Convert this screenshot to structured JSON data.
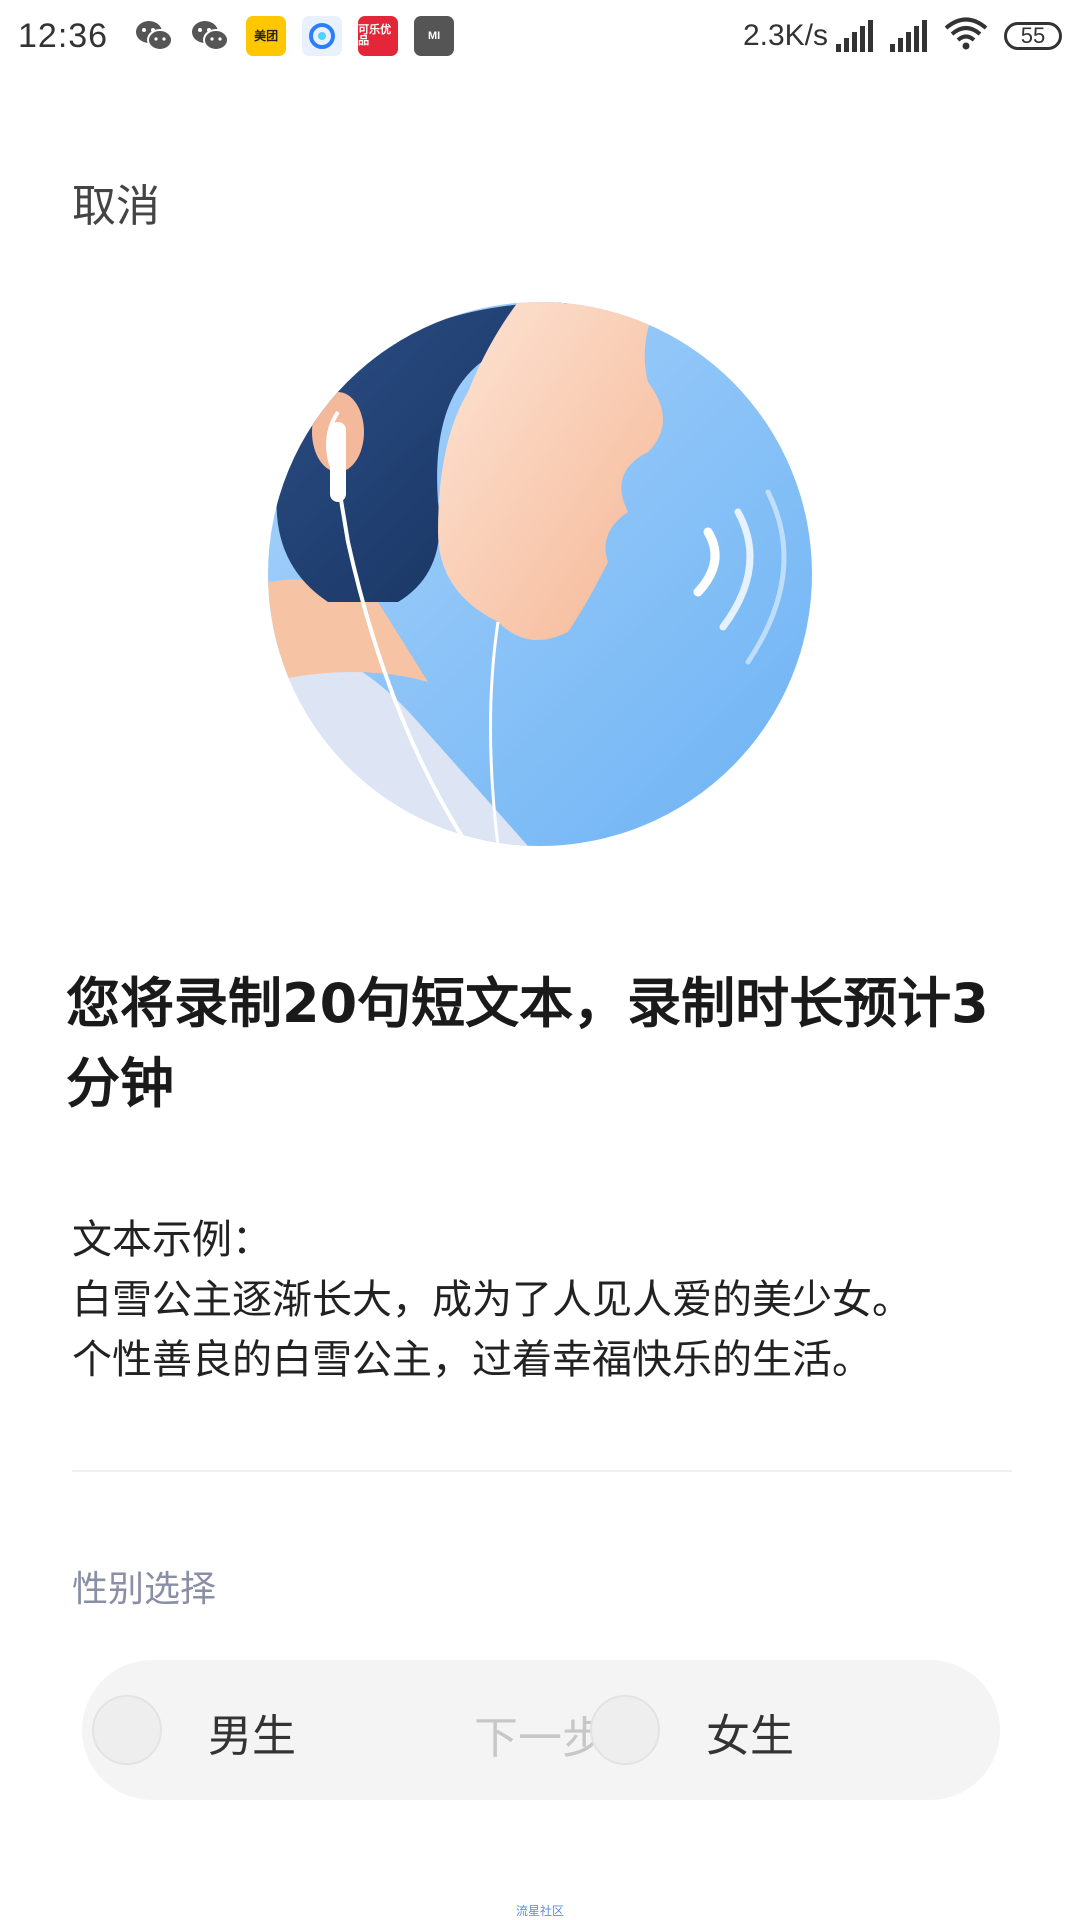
{
  "status_bar": {
    "time": "12:36",
    "net_speed": "2.3K/s",
    "battery": "55",
    "notif_meituan": "美团",
    "notif_kele": "可乐优品",
    "notif_mi": "MI"
  },
  "header": {
    "cancel_label": "取消"
  },
  "main": {
    "headline": "您将录制20句短文本，录制时长预计3分钟",
    "example_title": "文本示例：",
    "example_lines": [
      "白雪公主逐渐长大，成为了人见人爱的美少女。",
      "个性善良的白雪公主，过着幸福快乐的生活。"
    ]
  },
  "gender": {
    "label": "性别选择",
    "male": "男生",
    "female": "女生",
    "next": "下一步"
  },
  "watermark": "流星社区",
  "colors": {
    "accent_label": "#8a8fa6",
    "disabled": "#c7c7c7",
    "pill_bg": "#f4f4f4"
  }
}
